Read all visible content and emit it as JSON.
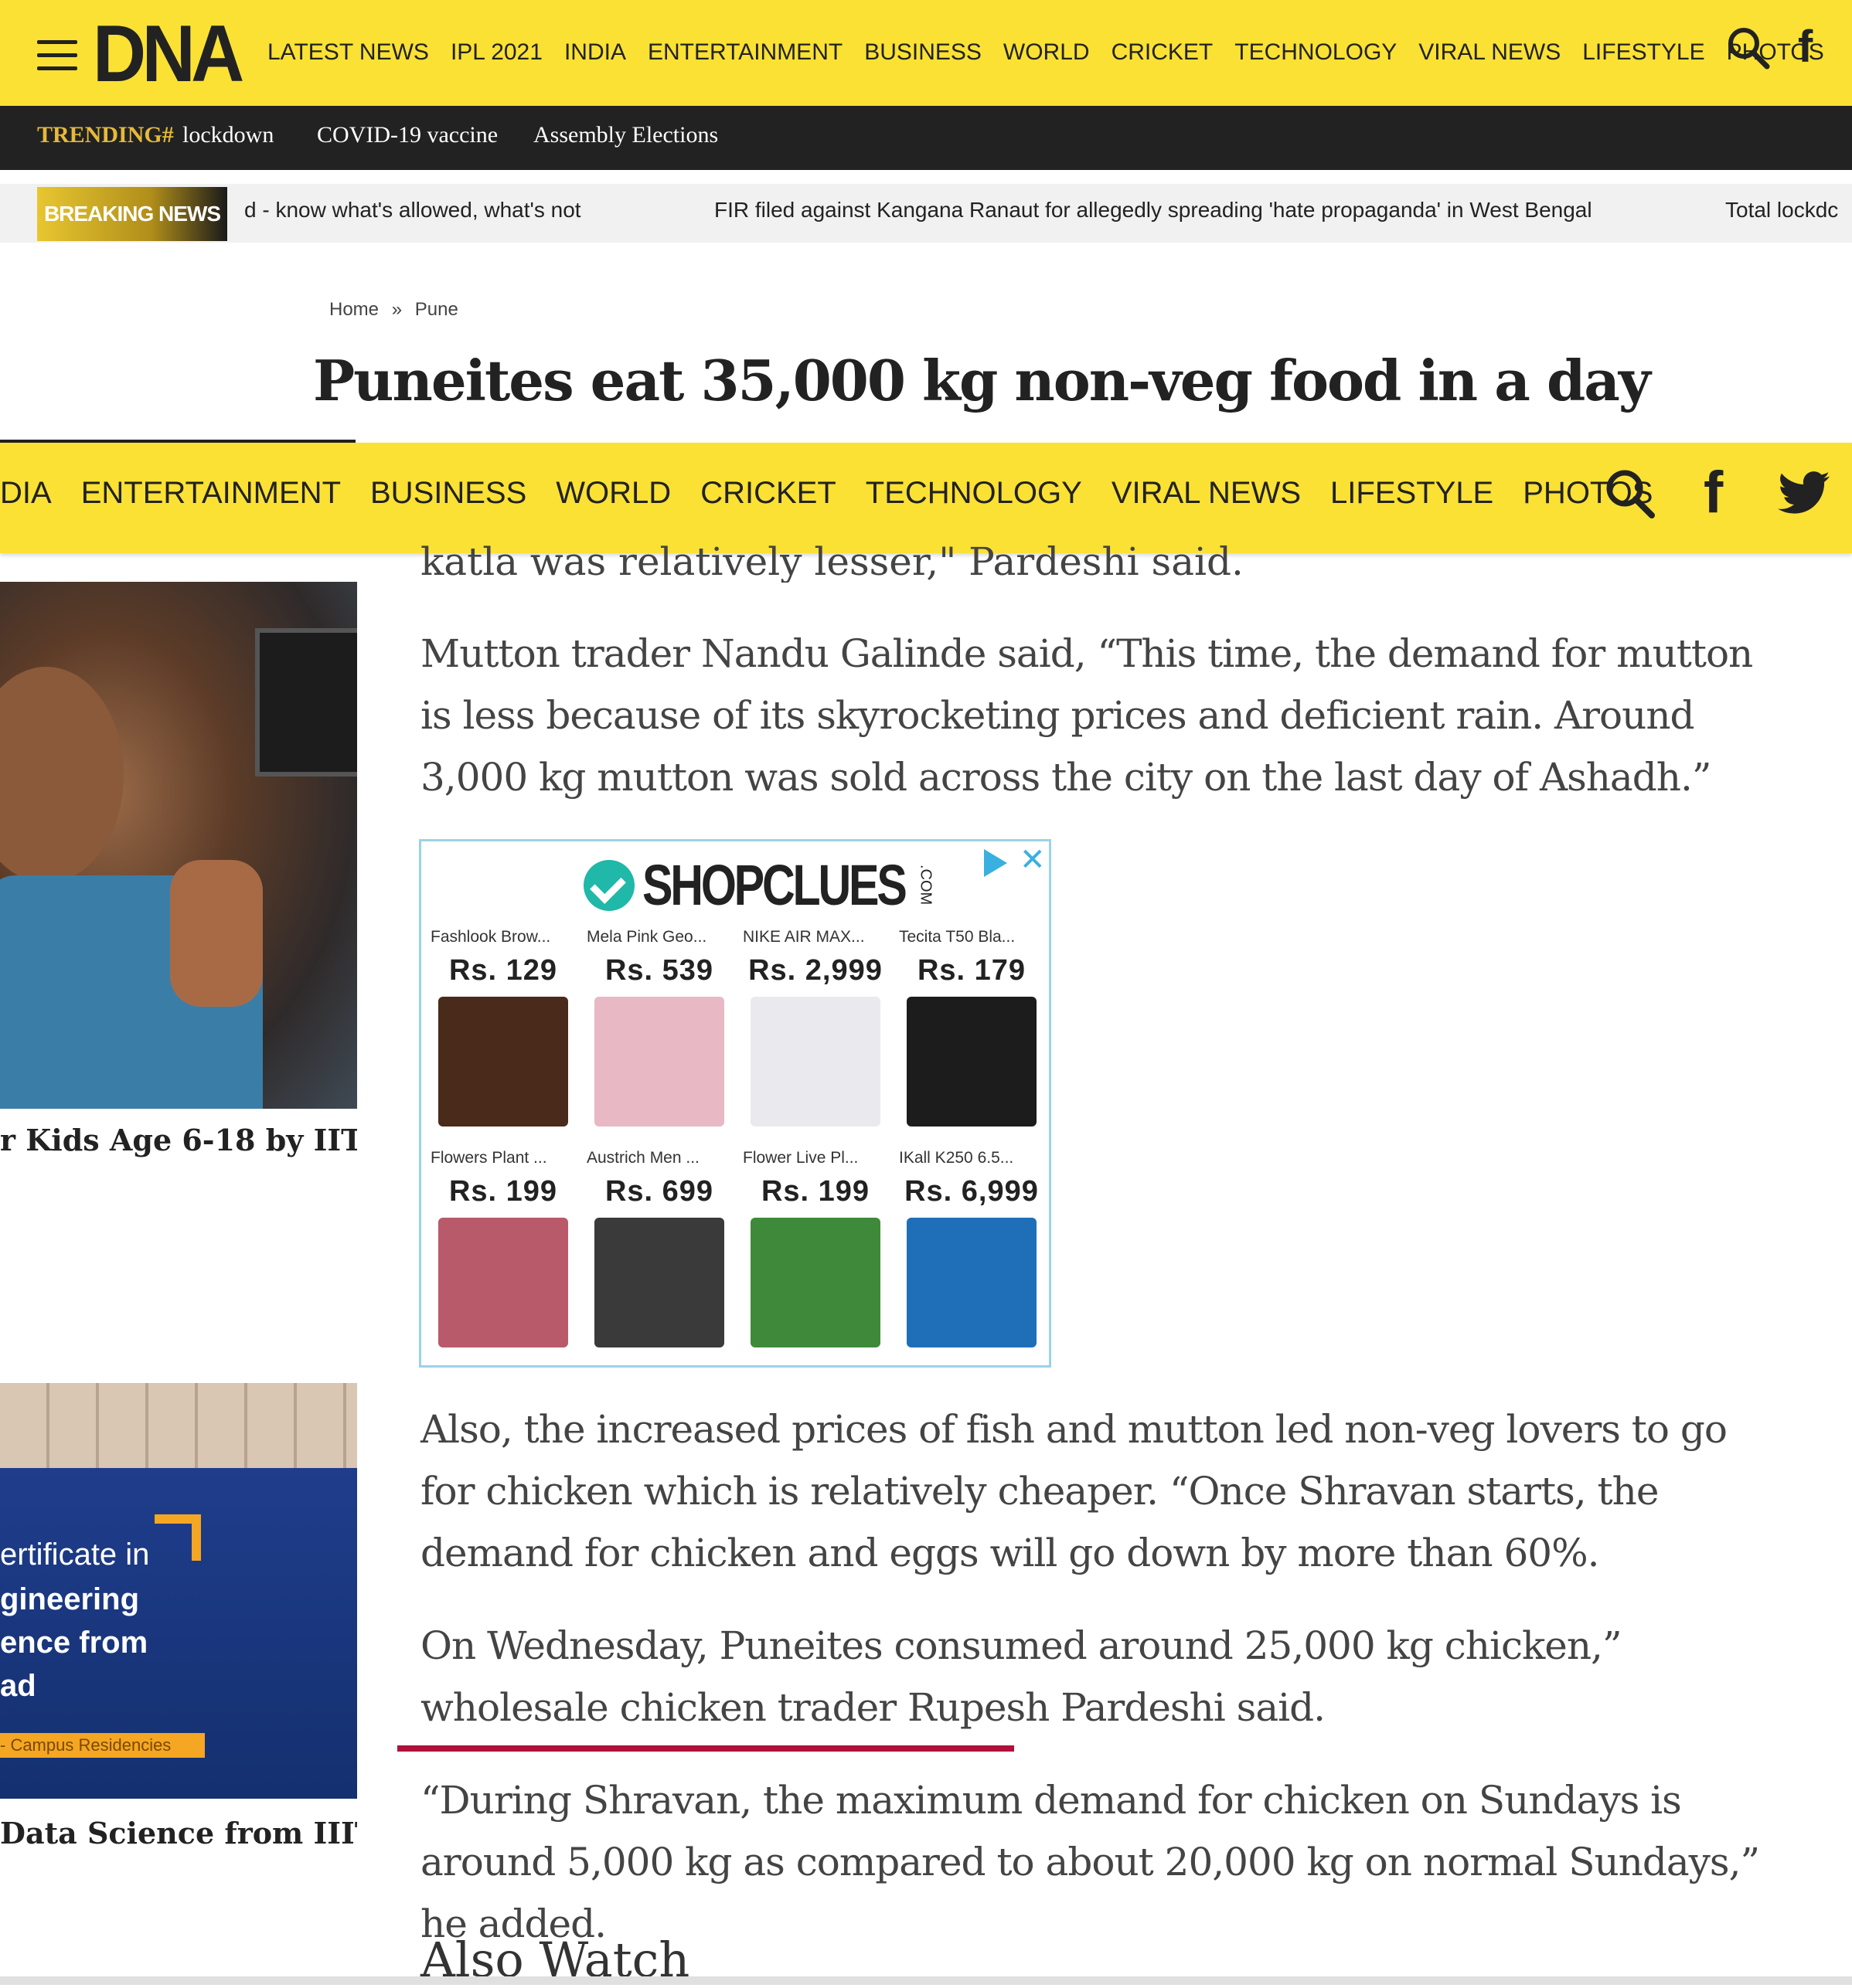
{
  "header": {
    "logo": "DNA",
    "nav": [
      "LATEST NEWS",
      "IPL 2021",
      "INDIA",
      "ENTERTAINMENT",
      "BUSINESS",
      "WORLD",
      "CRICKET",
      "TECHNOLOGY",
      "VIRAL NEWS",
      "LIFESTYLE",
      "PHOTOS"
    ],
    "facebook": "f"
  },
  "trending": {
    "label": "TRENDING#",
    "items": [
      "lockdown",
      "COVID-19 vaccine",
      "Assembly Elections"
    ]
  },
  "breaking": {
    "label": "BREAKING NEWS",
    "items": [
      "d - know what's allowed, what's not",
      "FIR filed against Kangana Ranaut for allegedly spreading 'hate propaganda' in West Bengal",
      "Total lockdc"
    ]
  },
  "breadcrumb": [
    "Home",
    "»",
    "Pune"
  ],
  "headline": "Puneites eat 35,000 kg non-veg food in a day",
  "sticky_nav": {
    "items": [
      "DIA",
      "ENTERTAINMENT",
      "BUSINESS",
      "WORLD",
      "CRICKET",
      "TECHNOLOGY",
      "VIRAL NEWS",
      "LIFESTYLE",
      "PHOTOS"
    ],
    "facebook": "f"
  },
  "sidebar": {
    "card1_title": "r Kids Age 6-18 by IIT/",
    "card2_image_lines": [
      "ertificate in",
      "gineering",
      "ence from",
      "ad"
    ],
    "card2_badge": "- Campus Residencies",
    "card2_title": "Data Science from IIIT"
  },
  "article": {
    "partial": "katla was relatively lesser,\" Pardeshi said.",
    "p1": "Mutton trader Nandu Galinde said, “This time, the demand for mutton is less because of its skyrocketing prices and deficient rain. Around 3,000 kg mutton was sold across the city on the last day of Ashadh.”",
    "p2": "Also, the increased prices of fish and mutton led non-veg lovers to go for chicken which is relatively cheaper. “Once Shravan starts, the demand for chicken and eggs will go down by more than 60%.",
    "p3": "On Wednesday, Puneites consumed around 25,000 kg chicken,” wholesale chicken trader Rupesh Pardeshi said.",
    "p4": "“During Shravan, the maximum demand for chicken on Sundays is around 5,000 kg as compared to about 20,000 kg on normal Sundays,” he added.",
    "also_watch": "Also Watch"
  },
  "ad": {
    "brand": "SHOPCLUES",
    "brand_suffix": ".COM",
    "close": "✕",
    "products": [
      {
        "name": "Fashlook Brow...",
        "price": "Rs. 129",
        "color": "#4a2a1a"
      },
      {
        "name": "Mela Pink Geo...",
        "price": "Rs. 539",
        "color": "#e8b8c4"
      },
      {
        "name": "NIKE AIR MAX...",
        "price": "Rs. 2,999",
        "color": "#e9e9ee"
      },
      {
        "name": "Tecita T50 Bla...",
        "price": "Rs. 179",
        "color": "#1c1c1c"
      },
      {
        "name": "Flowers Plant ...",
        "price": "Rs. 199",
        "color": "#b85a6a"
      },
      {
        "name": "Austrich Men ...",
        "price": "Rs. 699",
        "color": "#3a3a3a"
      },
      {
        "name": "Flower Live Pl...",
        "price": "Rs. 199",
        "color": "#3f8a3a"
      },
      {
        "name": "IKall K250 6.5...",
        "price": "Rs. 6,999",
        "color": "#1f6fb8"
      }
    ]
  }
}
